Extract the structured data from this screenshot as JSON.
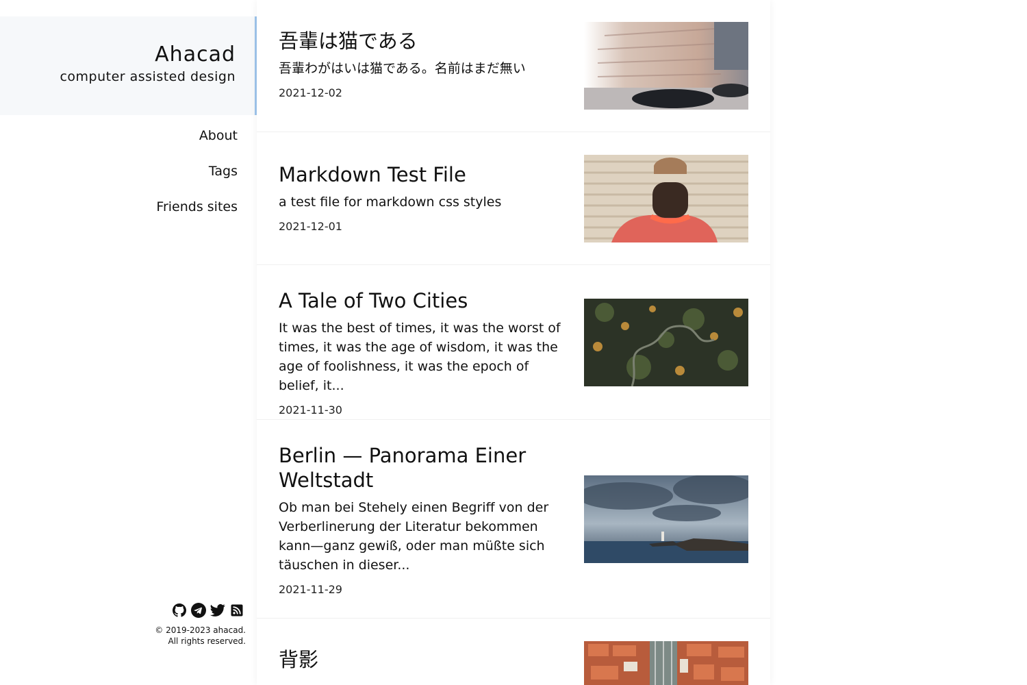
{
  "site": {
    "title": "Ahacad",
    "subtitle": "computer assisted design"
  },
  "nav": {
    "items": [
      {
        "label": "About"
      },
      {
        "label": "Tags"
      },
      {
        "label": "Friends sites"
      }
    ]
  },
  "social": {
    "icons": [
      "github-icon",
      "telegram-icon",
      "twitter-icon",
      "rss-icon"
    ]
  },
  "footer": {
    "copyright_line1": "© 2019-2023 ahacad.",
    "copyright_line2": "All rights reserved."
  },
  "posts": [
    {
      "title": "吾輩は猫である",
      "excerpt": "吾輩わがはいは猫である。名前はまだ無い",
      "date": "2021-12-02",
      "image": "street-with-moving-cars"
    },
    {
      "title": "Markdown Test File",
      "excerpt": "a test file for markdown css styles",
      "date": "2021-12-01",
      "image": "person-with-red-necklace"
    },
    {
      "title": "A Tale of Two Cities",
      "excerpt": "It was the best of times, it was the worst of times, it was the age of wisdom, it was the age of foolishness, it was the epoch of belief, it...",
      "date": "2021-11-30",
      "image": "aerial-forest-road"
    },
    {
      "title": "Berlin — Panorama Einer Weltstadt",
      "excerpt": "Ob man bei Stehely einen Begriff von der Verberlinerung der Literatur bekommen kann—ganz gewiß, oder man müßte sich täuschen in dieser...",
      "date": "2021-11-29",
      "image": "stormy-sea-lighthouse"
    },
    {
      "title": "背影",
      "excerpt": "",
      "date": "",
      "image": "aerial-city-rooftops"
    }
  ]
}
